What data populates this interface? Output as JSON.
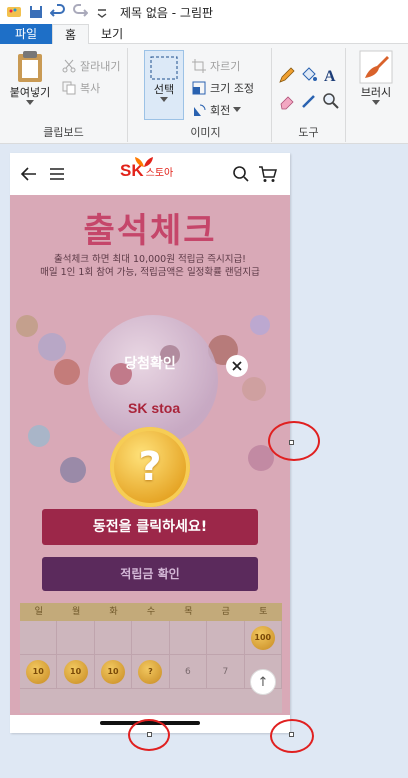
{
  "window": {
    "title": "제목 없음 - 그림판"
  },
  "tabs": [
    {
      "label": "파일"
    },
    {
      "label": "홈"
    },
    {
      "label": "보기"
    }
  ],
  "ribbon": {
    "clipboard": {
      "paste": "붙여넣기",
      "cut": "잘라내기",
      "copy": "복사",
      "group": "클립보드"
    },
    "image": {
      "select": "선택",
      "crop": "자르기",
      "resize": "크기 조정",
      "rotate": "회전",
      "group": "이미지"
    },
    "tools": {
      "group": "도구"
    },
    "brushes": {
      "label": "브러시"
    }
  },
  "phone": {
    "brand_sk": "SK",
    "brand_stoa": "스토아",
    "page_title": "출석체크",
    "desc_line1": "출석체크 하면 최대 10,000원 적립금 즉시지급!",
    "desc_line2": "매일 1인 1회 참여 가능, 적립금액은 일정확률 랜덤지급",
    "globe_mark": "SK stoa",
    "cta_primary": "동전을 클릭하세요!",
    "cta_secondary": "적립금 확인",
    "calendar": {
      "days": [
        "일",
        "월",
        "화",
        "수",
        "목",
        "금",
        "토"
      ],
      "row1": [
        "",
        "",
        "",
        "",
        "",
        "",
        "100"
      ],
      "row2": [
        "10",
        "10",
        "10",
        "?",
        "6",
        "7",
        ""
      ]
    },
    "popup": {
      "title": "당첨확인",
      "coin_symbol": "?"
    },
    "scroll_top": "↑"
  },
  "colors": {
    "file_tab": "#1e6fc7",
    "annotation": "#e02020",
    "sk_red": "#e2231a"
  }
}
